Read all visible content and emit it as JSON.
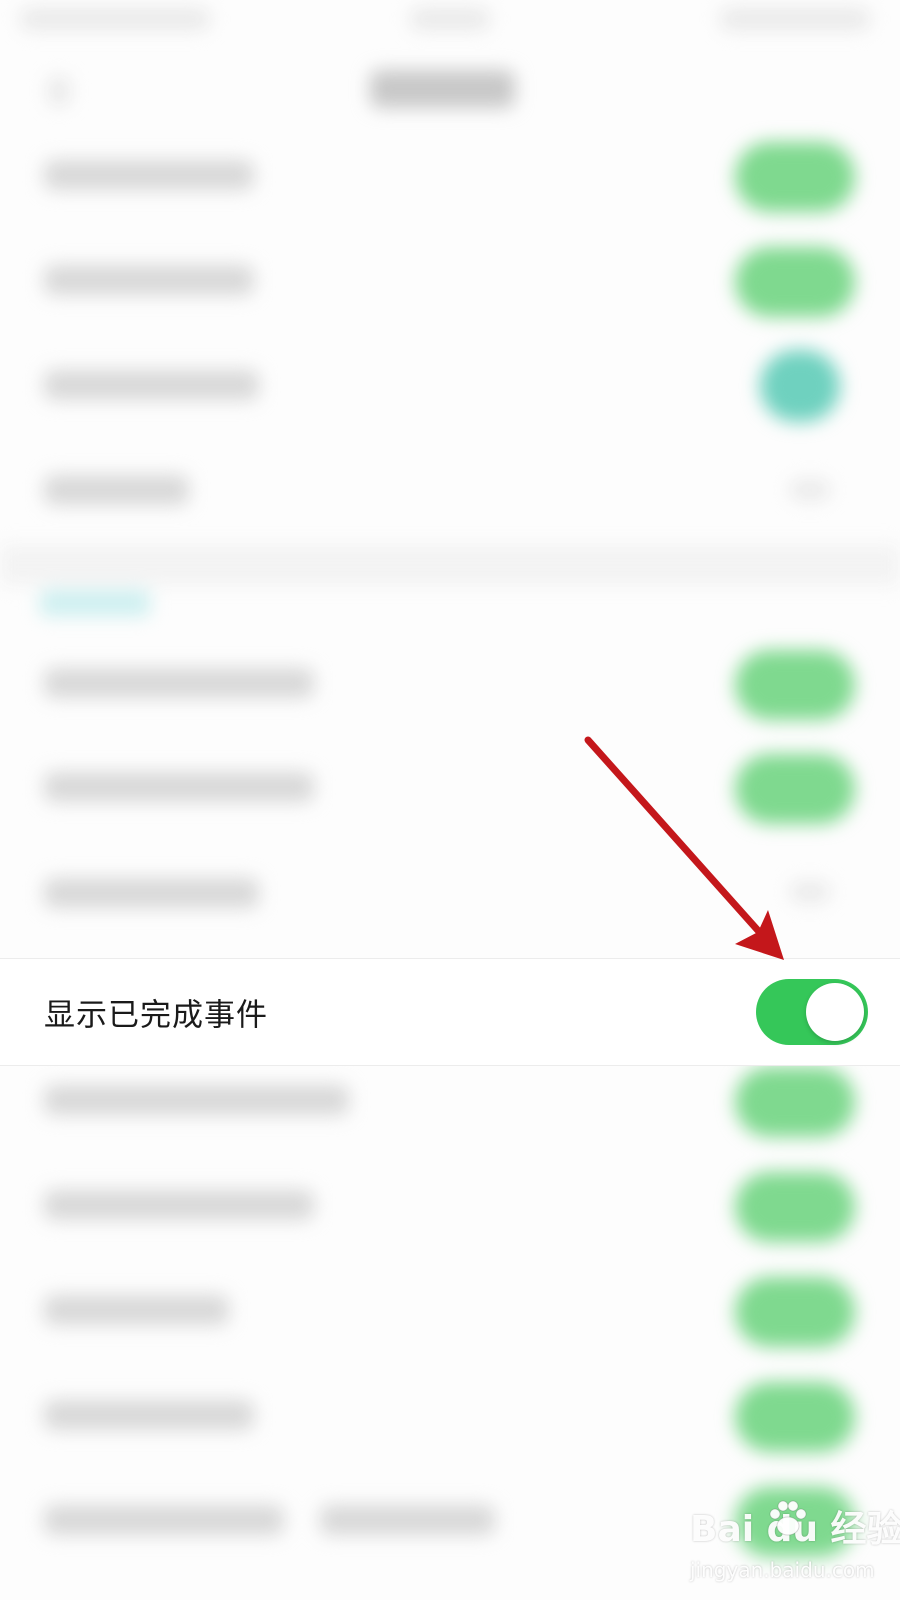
{
  "setting_row": {
    "label": "显示已完成事件",
    "toggle_state": "on",
    "toggle_color": "#35c759"
  },
  "annotation": {
    "arrow_color": "#c4171b",
    "points_to": "toggle-switch"
  },
  "watermark": {
    "brand": "Bai du 经验",
    "url": "jingyan.baidu.com",
    "icon": "paw-icon"
  }
}
